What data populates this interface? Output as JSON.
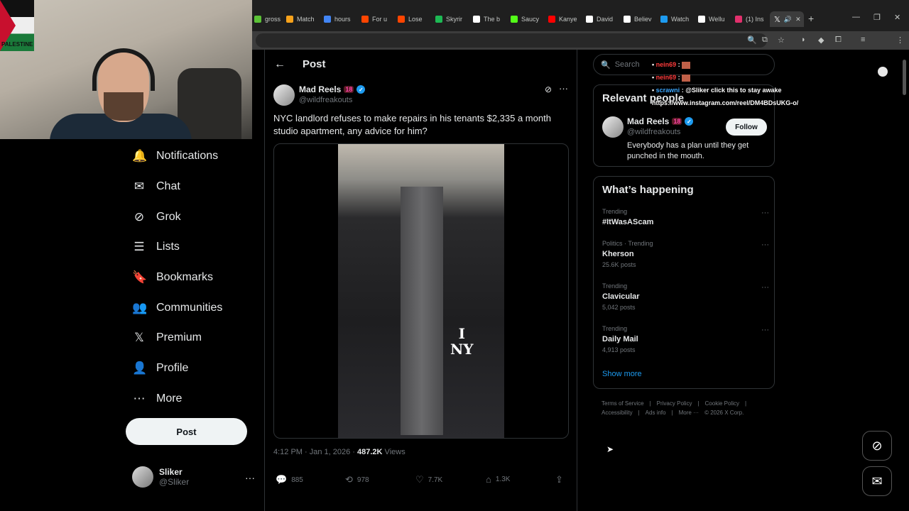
{
  "browser": {
    "tabs": [
      {
        "label": "gross",
        "color": "#5bc236"
      },
      {
        "label": "Match",
        "color": "#f7a21b"
      },
      {
        "label": "hours",
        "color": "#4285f4"
      },
      {
        "label": "For u",
        "color": "#ff4500"
      },
      {
        "label": "Lose",
        "color": "#ff4500"
      },
      {
        "label": "Skyrir",
        "color": "#1db954"
      },
      {
        "label": "The b",
        "color": "#ffffff"
      },
      {
        "label": "Saucy",
        "color": "#53fc18"
      },
      {
        "label": "Kanye",
        "color": "#ff0000"
      },
      {
        "label": "David",
        "color": "#ffffff"
      },
      {
        "label": "Believ",
        "color": "#ffffff"
      },
      {
        "label": "Watch",
        "color": "#1d9bf0"
      },
      {
        "label": "Wellu",
        "color": "#ffffff"
      },
      {
        "label": "(1) Ins",
        "color": "#e1306c"
      }
    ],
    "active_tab_icon": "x-logo-icon",
    "new_tab": "+"
  },
  "webcam": {
    "flag_text": "PALESTINE"
  },
  "nav": [
    {
      "key": "notifications",
      "label": "Notifications",
      "icon": "🔔"
    },
    {
      "key": "chat",
      "label": "Chat",
      "icon": "✉"
    },
    {
      "key": "grok",
      "label": "Grok",
      "icon": "⊘"
    },
    {
      "key": "lists",
      "label": "Lists",
      "icon": "☰"
    },
    {
      "key": "bookmarks",
      "label": "Bookmarks",
      "icon": "🔖"
    },
    {
      "key": "communities",
      "label": "Communities",
      "icon": "👥"
    },
    {
      "key": "premium",
      "label": "Premium",
      "icon": "𝕏"
    },
    {
      "key": "profile",
      "label": "Profile",
      "icon": "👤"
    },
    {
      "key": "more",
      "label": "More",
      "icon": "⋯"
    }
  ],
  "post_button": "Post",
  "account": {
    "name": "Sliker",
    "handle": "@Sliker"
  },
  "main": {
    "title": "Post",
    "author": {
      "name": "Mad Reels",
      "badge": "18",
      "handle": "@wildfreakouts"
    },
    "text": "NYC landlord refuses to make repairs in his tenants $2,335 a month studio apartment, any advice for him?",
    "video_overlay": {
      "line1": "I",
      "line2": "NY"
    },
    "timestamp": "4:12 PM · Jan 1, 2026 · ",
    "views_count": "487.2K",
    "views_label": " Views",
    "actions": {
      "replies": "885",
      "reposts": "978",
      "likes": "7.7K",
      "bookmarks": "1.3K"
    }
  },
  "sidebar": {
    "search_placeholder": "Search",
    "relevant_title": "Relevant people",
    "relevant": {
      "name": "Mad Reels",
      "badge": "18",
      "handle": "@wildfreakouts",
      "bio": "Everybody has a plan until they get punched in the mouth.",
      "follow": "Follow"
    },
    "happening_title": "What’s happening",
    "trends": [
      {
        "context": "Trending",
        "name": "#ItWasAScam",
        "count": ""
      },
      {
        "context": "Politics · Trending",
        "name": "Kherson",
        "count": "25.6K posts"
      },
      {
        "context": "Trending",
        "name": "Clavicular",
        "count": "5,042 posts"
      },
      {
        "context": "Trending",
        "name": "Daily Mail",
        "count": "4,913 posts"
      }
    ],
    "show_more": "Show more",
    "footer": [
      "Terms of Service",
      "|",
      "Privacy Policy",
      "|",
      "Cookie Policy",
      "|",
      "Accessibility",
      "|",
      "Ads info",
      "|",
      "More ···",
      "© 2026 X Corp."
    ]
  },
  "chat_overlay": [
    {
      "user": "nein69",
      "msg": ""
    },
    {
      "user": "nein69",
      "msg": ""
    },
    {
      "user": "scrawni",
      "msg": "@Sliker click this to stay awake"
    },
    {
      "user": "",
      "msg": "https://www.instagram.com/reel/DM4BDsUKG-o/"
    }
  ]
}
